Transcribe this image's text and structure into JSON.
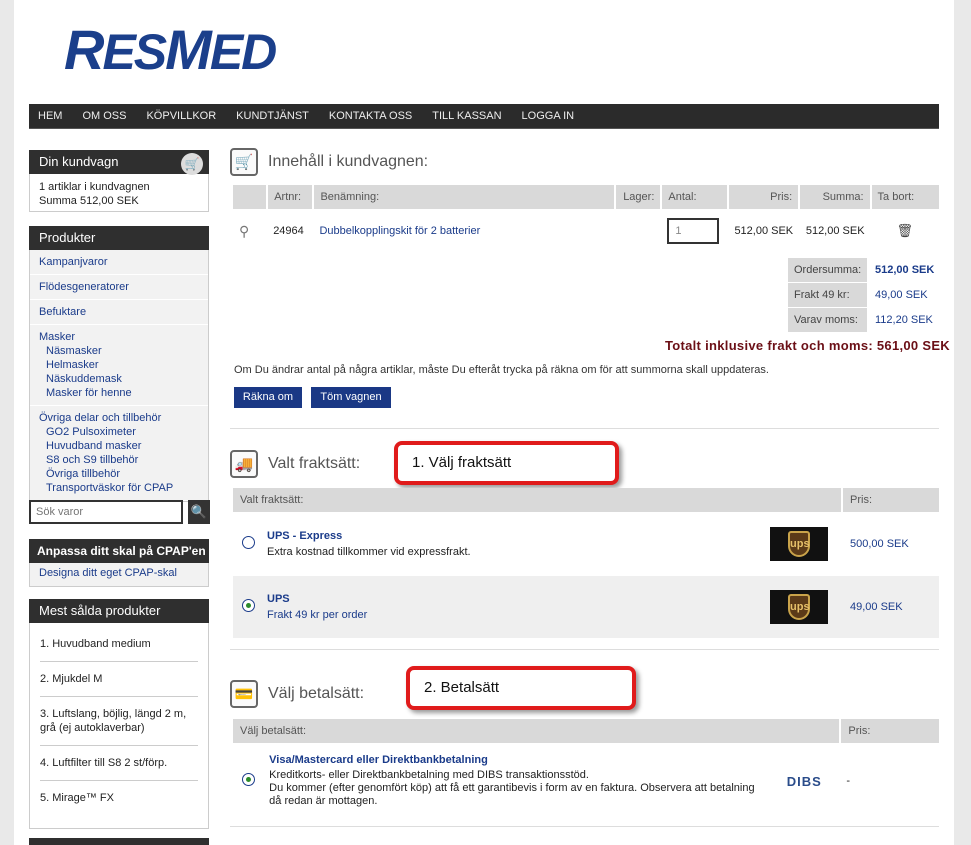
{
  "logo": {
    "part1": "R",
    "part2": "ES",
    "part3": "M",
    "part4": "ED"
  },
  "nav": [
    "HEM",
    "OM OSS",
    "KÖPVILLKOR",
    "KUNDTJÄNST",
    "KONTAKTA OSS",
    "TILL KASSAN",
    "LOGGA IN"
  ],
  "sidebar": {
    "cart_title": "Din kundvagn",
    "cart_line1": "1 artiklar i kundvagnen",
    "cart_line2": "Summa 512,00 SEK",
    "products_title": "Produkter",
    "groups": [
      {
        "top": "Kampanjvaror",
        "subs": []
      },
      {
        "top": "Flödesgeneratorer",
        "subs": []
      },
      {
        "top": "Befuktare",
        "subs": []
      },
      {
        "top": "Masker",
        "subs": [
          "Näsmasker",
          "Helmasker",
          "Näskuddemask",
          "Masker för henne"
        ]
      },
      {
        "top": "Övriga delar och tillbehör",
        "subs": [
          "GO2 Pulsoximeter",
          "Huvudband masker",
          "S8 och S9 tillbehör",
          "Övriga tillbehör",
          "Transportväskor för CPAP"
        ]
      }
    ],
    "search_placeholder": "Sök varor",
    "custom_title": "Anpassa ditt skal på CPAP'en",
    "custom_link": "Designa ditt eget CPAP-skal",
    "best_title": "Mest sålda produkter",
    "best": [
      "1. Huvudband medium",
      "2. Mjukdel M",
      "3. Luftslang, böjlig, längd 2 m, grå (ej autoklaverbar)",
      "4. Luftfilter till S8 2 st/förp.",
      "5. Mirage™ FX"
    ]
  },
  "cart": {
    "title": "Innehåll i kundvagnen:",
    "headers": [
      "Artnr:",
      "Benämning:",
      "Lager:",
      "Antal:",
      "Pris:",
      "Summa:",
      "Ta bort:"
    ],
    "row": {
      "artnr": "24964",
      "name": "Dubbelkopplingskit för 2 batterier",
      "qty": "1",
      "price": "512,00 SEK",
      "sum": "512,00 SEK"
    },
    "ordersumma_label": "Ordersumma:",
    "ordersumma": "512,00 SEK",
    "frakt_label": "Frakt 49 kr:",
    "frakt": "49,00 SEK",
    "moms_label": "Varav moms:",
    "moms": "112,20 SEK",
    "total": "Totalt inklusive frakt och moms: 561,00 SEK",
    "note": "Om Du ändrar antal på några artiklar, måste Du efteråt trycka på räkna om för att summorna skall uppdateras.",
    "recalc": "Räkna om",
    "empty": "Töm vagnen"
  },
  "shipping": {
    "title": "Valt fraktsätt:",
    "callout": "1. Välj fraktsätt",
    "header_left": "Valt fraktsätt:",
    "header_right": "Pris:",
    "options": [
      {
        "name": "UPS - Express",
        "desc": "Extra kostnad tillkommer vid expressfrakt.",
        "price": "500,00 SEK",
        "logo": "ups"
      },
      {
        "name": "UPS",
        "desc": "Frakt 49 kr per order",
        "price": "49,00 SEK",
        "logo": "ups"
      }
    ]
  },
  "payment": {
    "title": "Välj betalsätt:",
    "callout": "2. Betalsätt",
    "header_left": "Välj betalsätt:",
    "header_right": "Pris:",
    "option": {
      "name": "Visa/Mastercard eller Direktbankbetalning",
      "desc1": "Kreditkorts- eller Direktbankbetalning med DIBS transaktionsstöd.",
      "desc2": "Du kommer (efter genomfört köp) att få ett garantibevis i form av en faktura. Observera att betalning då redan är mottagen.",
      "logo": "DIBS",
      "price": "-"
    }
  }
}
